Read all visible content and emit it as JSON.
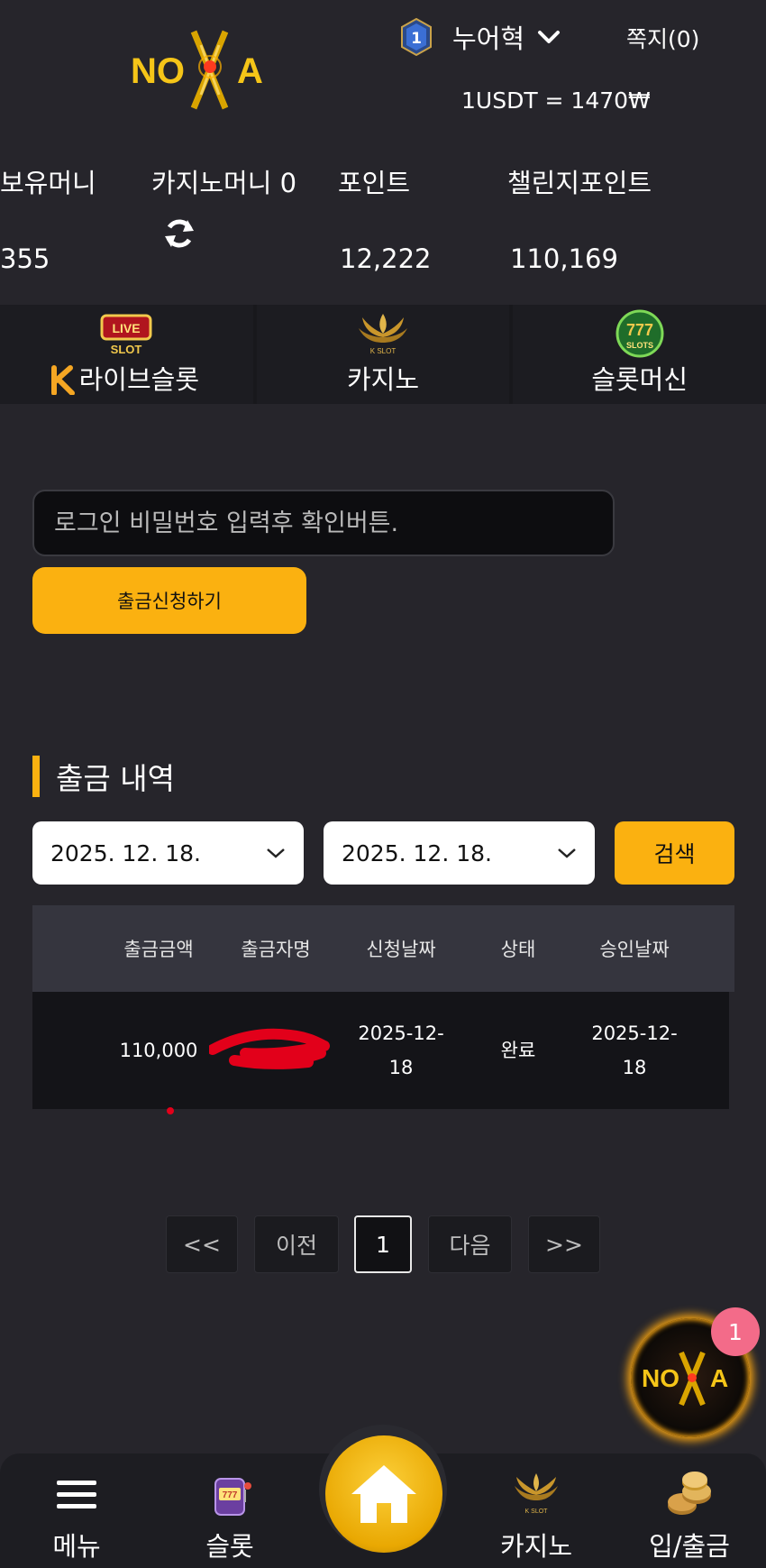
{
  "header": {
    "logo_text": "NOVA",
    "level": "1",
    "username": "누어혁",
    "messages": "쪽지(0)",
    "exchange_rate": "1USDT = 1470₩"
  },
  "balances": {
    "held_money_label": "보유머니",
    "held_money_value": "355",
    "casino_money_label": "카지노머니 0",
    "points_label": "포인트",
    "points_value": "12,222",
    "challenge_points_label": "챌린지포인트",
    "challenge_points_value": "110,169"
  },
  "game_tabs": [
    {
      "label": "라이브슬롯",
      "icon": "live-slot-icon"
    },
    {
      "label": "카지노",
      "icon": "k-slot-casino-icon"
    },
    {
      "label": "슬롯머신",
      "icon": "777-slots-icon"
    }
  ],
  "withdraw_form": {
    "password_placeholder": "로그인 비밀번호 입력후 확인버튼.",
    "submit_label": "출금신청하기"
  },
  "history": {
    "title": "출금 내역",
    "date_from": "2025. 12. 18.",
    "date_to": "2025. 12. 18.",
    "search_label": "검색",
    "columns": [
      "출금금액",
      "출금자명",
      "신청날짜",
      "상태",
      "승인날짜"
    ],
    "rows": [
      {
        "amount": "110,000",
        "request_date_1": "2025-12-",
        "request_date_2": "18",
        "status": "완료",
        "approve_date_1": "2025-12-",
        "approve_date_2": "18"
      }
    ]
  },
  "pagination": {
    "first": "<<",
    "prev": "이전",
    "current": "1",
    "next": "다음",
    "last": ">>"
  },
  "notification_count": "1",
  "bottom_nav": {
    "menu": "메뉴",
    "slot": "슬롯",
    "casino": "카지노",
    "deposit_withdraw": "입/출금"
  },
  "colors": {
    "accent": "#fbb110",
    "background": "#26252b",
    "badge": "#f36b89"
  }
}
